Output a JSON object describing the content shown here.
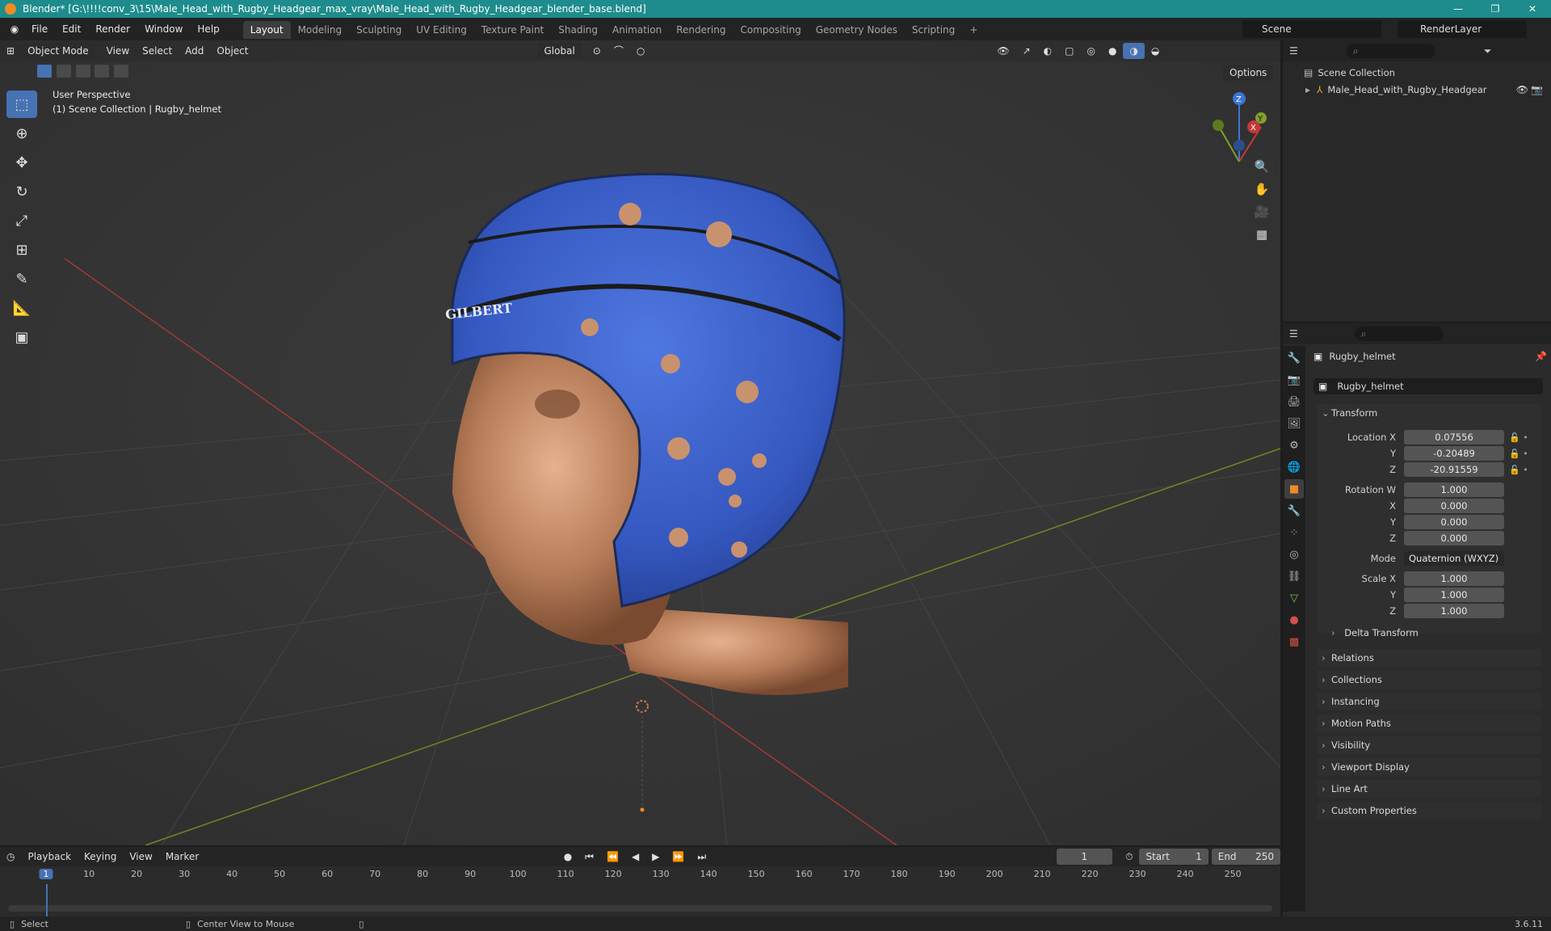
{
  "titlebar": {
    "title": "Blender* [G:\\!!!!conv_3\\15\\Male_Head_with_Rugby_Headgear_max_vray\\Male_Head_with_Rugby_Headgear_blender_base.blend]",
    "buttons": [
      "—",
      "❐",
      "✕"
    ]
  },
  "menubar": {
    "menus": [
      "File",
      "Edit",
      "Render",
      "Window",
      "Help"
    ],
    "workspaces": [
      "Layout",
      "Modeling",
      "Sculpting",
      "UV Editing",
      "Texture Paint",
      "Shading",
      "Animation",
      "Rendering",
      "Compositing",
      "Geometry Nodes",
      "Scripting"
    ],
    "add_tab": "+",
    "scene": "Scene",
    "render_layer": "RenderLayer"
  },
  "viewport": {
    "mode": "Object Mode",
    "menus": [
      "View",
      "Select",
      "Add",
      "Object"
    ],
    "transform_orientation": "Global",
    "options": "Options",
    "view_name": "User Perspective",
    "collection_path": "(1) Scene Collection | Rugby_helmet",
    "helmet_logo": "GILBERT",
    "gizmo_axes": [
      "Z",
      "Y",
      "X"
    ]
  },
  "outliner": {
    "root": "Scene Collection",
    "items": [
      "Male_Head_with_Rugby_Headgear"
    ]
  },
  "properties": {
    "object_name": "Rugby_helmet",
    "datablock_name": "Rugby_helmet",
    "transform_label": "Transform",
    "location": {
      "label": "Location X",
      "y_label": "Y",
      "z_label": "Z",
      "x": "0.07556",
      "y": "-0.20489",
      "z": "-20.91559"
    },
    "rotation": {
      "label": "Rotation W",
      "x_label": "X",
      "y_label": "Y",
      "z_label": "Z",
      "w": "1.000",
      "x": "0.000",
      "y": "0.000",
      "z": "0.000"
    },
    "mode": {
      "label": "Mode",
      "value": "Quaternion (WXYZ)"
    },
    "scale": {
      "label": "Scale X",
      "y_label": "Y",
      "z_label": "Z",
      "x": "1.000",
      "y": "1.000",
      "z": "1.000"
    },
    "delta_transform": "Delta Transform",
    "panels": [
      "Relations",
      "Collections",
      "Instancing",
      "Motion Paths",
      "Visibility",
      "Viewport Display",
      "Line Art",
      "Custom Properties"
    ]
  },
  "timeline": {
    "menus": [
      "Playback",
      "Keying",
      "View",
      "Marker"
    ],
    "current_frame": "1",
    "start_label": "Start",
    "start": "1",
    "end_label": "End",
    "end": "250",
    "ticks": [
      "1",
      "10",
      "20",
      "30",
      "40",
      "50",
      "60",
      "70",
      "80",
      "90",
      "100",
      "110",
      "120",
      "130",
      "140",
      "150",
      "160",
      "170",
      "180",
      "190",
      "200",
      "210",
      "220",
      "230",
      "240",
      "250"
    ]
  },
  "statusbar": {
    "select": "Select",
    "center_view": "Center View to Mouse",
    "version": "3.6.11"
  },
  "colors": {
    "accent": "#4772b3",
    "titlebar": "#1e8c8c",
    "helmet": "#3a5fc8",
    "x_axis": "#c23a3a",
    "y_axis": "#7fa12a",
    "z_axis": "#3b74d6"
  }
}
